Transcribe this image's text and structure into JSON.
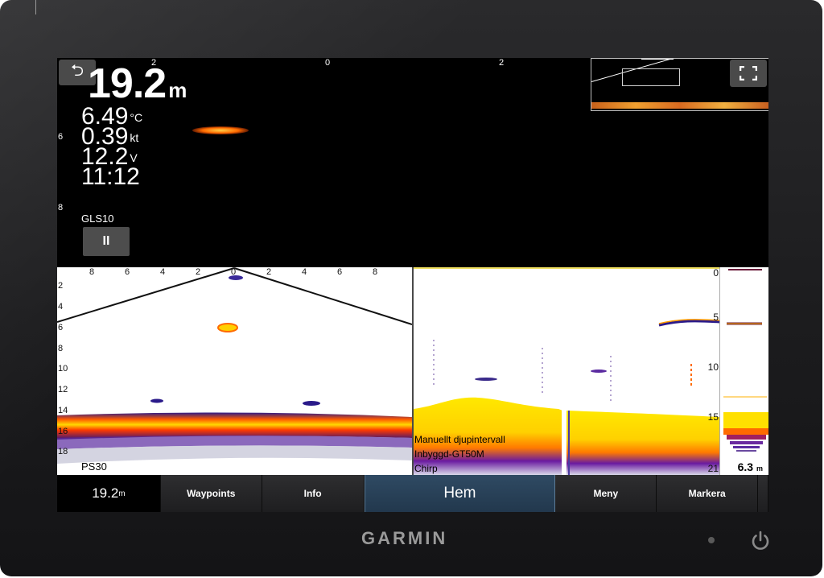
{
  "device": {
    "brand": "GARMIN"
  },
  "top_panel": {
    "range_scale": [
      "2",
      "0",
      "2"
    ],
    "depth_scale": [
      "6",
      "8"
    ],
    "depth": {
      "value": "19.2",
      "unit": "m"
    },
    "readouts": [
      {
        "value": "6.49",
        "unit": "°C"
      },
      {
        "value": "0.39",
        "unit": "kt"
      },
      {
        "value": "12.2",
        "unit": "V"
      },
      {
        "value": "11:12",
        "unit": ""
      }
    ],
    "source_label": "GLS10",
    "pause_label": "II",
    "back_icon": "back-arrow-icon",
    "fullscreen_icon": "fullscreen-icon"
  },
  "panoptix_panel": {
    "range_scale": [
      "8",
      "6",
      "4",
      "2",
      "0",
      "2",
      "4",
      "6",
      "8"
    ],
    "depth_scale": [
      "2",
      "4",
      "6",
      "8",
      "10",
      "12",
      "14",
      "16",
      "18"
    ],
    "label": "PS30"
  },
  "chirp_panel": {
    "depth_scale": [
      "0",
      "5",
      "10",
      "15",
      "21"
    ],
    "info_lines": [
      "Manuellt djupintervall",
      "Inbyggd-GT50M",
      "Chirp"
    ],
    "flasher_depth": {
      "value": "6.3",
      "unit": "m"
    }
  },
  "bottom_bar": {
    "depth": {
      "value": "19.2",
      "unit": "m"
    },
    "buttons": [
      "Waypoints",
      "Info",
      "Hem",
      "Meny",
      "Markera"
    ]
  },
  "colors": {
    "accent_bar": "#22384d",
    "sonar_hot": "#ffd400",
    "sonar_mid": "#ff4a00",
    "sonar_cold": "#2a1a8a"
  }
}
